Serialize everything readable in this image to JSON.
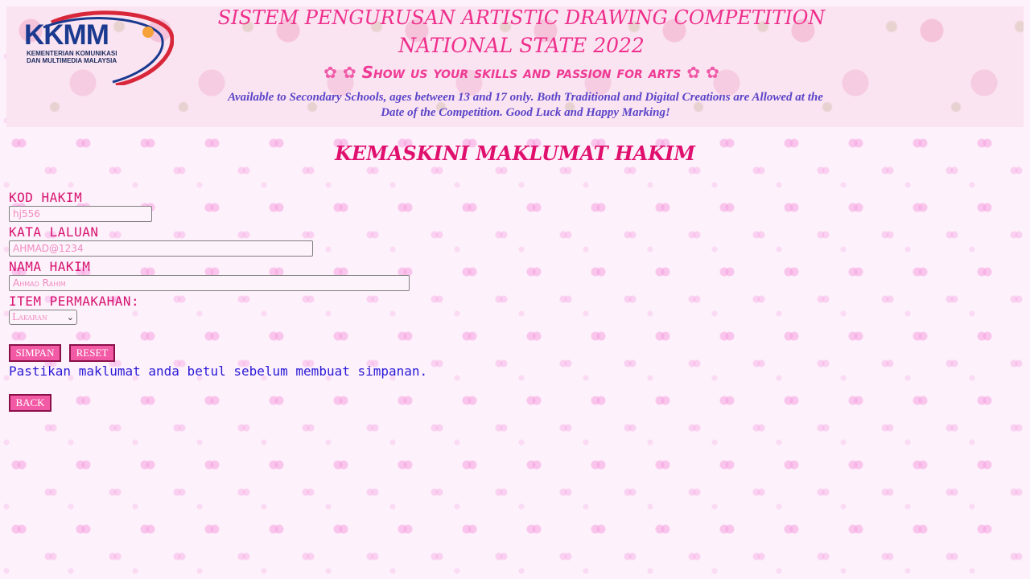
{
  "header": {
    "logo": {
      "text": "KKMM",
      "subtitle_line1": "KEMENTERIAN KOMUNIKASI",
      "subtitle_line2": "DAN MULTIMEDIA MALAYSIA"
    },
    "title_line1": "SISTEM PENGURUSAN ARTISTIC DRAWING COMPETITION",
    "title_line2": "NATIONAL STATE 2022",
    "tagline": "Show us your skills and passion for arts",
    "flower_icon": "✿",
    "availability_line1": "Available to Secondary Schools, ages between 13 and 17 only. Both Traditional and Digital Creations are Allowed at the",
    "availability_line2": "Date of the Competition. Good Luck and Happy Marking!"
  },
  "page_title": "KEMASKINI MAKLUMAT HAKIM",
  "form": {
    "kod_label": "KOD HAKIM",
    "kod_value": "hj556",
    "kata_label": "KATA LALUAN",
    "kata_value": "AHMAD@1234",
    "nama_label": "NAMA HAKIM",
    "nama_value": "Ahmad Rahim",
    "item_label": "ITEM PERMAKAHAN:",
    "item_selected": "Lakaran",
    "save_label": "SIMPAN",
    "reset_label": "RESET",
    "note": "Pastikan maklumat anda betul sebelum membuat simpanan.",
    "back_label": "BACK"
  },
  "colors": {
    "title_pink": "#ee2f8c",
    "label_pink": "#d6136f",
    "button_pink": "#f25aa5",
    "note_blue": "#2a1ad6",
    "avail_purple": "#5a44c8"
  }
}
